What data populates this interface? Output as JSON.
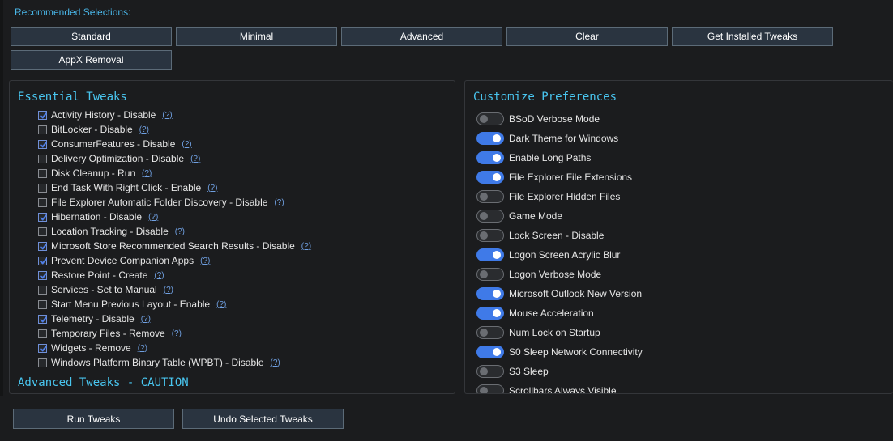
{
  "recommended": {
    "label": "Recommended Selections:",
    "buttons": [
      "Standard",
      "Minimal",
      "Advanced",
      "Clear",
      "Get Installed Tweaks",
      "AppX Removal"
    ]
  },
  "essential": {
    "title": "Essential Tweaks",
    "help_label": "(?)",
    "items": [
      {
        "label": "Activity History - Disable",
        "checked": true
      },
      {
        "label": "BitLocker - Disable",
        "checked": false
      },
      {
        "label": "ConsumerFeatures - Disable",
        "checked": true
      },
      {
        "label": "Delivery Optimization - Disable",
        "checked": false
      },
      {
        "label": "Disk Cleanup - Run",
        "checked": false
      },
      {
        "label": "End Task With Right Click - Enable",
        "checked": false
      },
      {
        "label": "File Explorer Automatic Folder Discovery - Disable",
        "checked": false
      },
      {
        "label": "Hibernation - Disable",
        "checked": true
      },
      {
        "label": "Location Tracking - Disable",
        "checked": false
      },
      {
        "label": "Microsoft Store Recommended Search Results - Disable",
        "checked": true
      },
      {
        "label": "Prevent Device Companion Apps",
        "checked": true
      },
      {
        "label": "Restore Point - Create",
        "checked": true
      },
      {
        "label": "Services - Set to Manual",
        "checked": false
      },
      {
        "label": "Start Menu Previous Layout - Enable",
        "checked": false
      },
      {
        "label": "Telemetry - Disable",
        "checked": true
      },
      {
        "label": "Temporary Files - Remove",
        "checked": false
      },
      {
        "label": "Widgets - Remove",
        "checked": true
      },
      {
        "label": "Windows Platform Binary Table (WPBT) - Disable",
        "checked": false
      }
    ]
  },
  "advanced": {
    "title": "Advanced Tweaks - CAUTION"
  },
  "preferences": {
    "title": "Customize Preferences",
    "items": [
      {
        "label": "BSoD Verbose Mode",
        "on": false
      },
      {
        "label": "Dark Theme for Windows",
        "on": true
      },
      {
        "label": "Enable Long Paths",
        "on": true
      },
      {
        "label": "File Explorer File Extensions",
        "on": true
      },
      {
        "label": "File Explorer Hidden Files",
        "on": false
      },
      {
        "label": "Game Mode",
        "on": false
      },
      {
        "label": "Lock Screen - Disable",
        "on": false
      },
      {
        "label": "Logon Screen Acrylic Blur",
        "on": true
      },
      {
        "label": "Logon Verbose Mode",
        "on": false
      },
      {
        "label": "Microsoft Outlook New Version",
        "on": true
      },
      {
        "label": "Mouse Acceleration",
        "on": true
      },
      {
        "label": "Num Lock on Startup",
        "on": false
      },
      {
        "label": "S0 Sleep Network Connectivity",
        "on": true
      },
      {
        "label": "S3 Sleep",
        "on": false
      },
      {
        "label": "Scrollbars Always Visible",
        "on": false
      }
    ]
  },
  "actions": {
    "run": "Run Tweaks",
    "undo": "Undo Selected Tweaks"
  },
  "colors": {
    "accent": "#49b6e8",
    "toggle_on": "#3f7ae8",
    "button_bg": "#2a3440"
  }
}
